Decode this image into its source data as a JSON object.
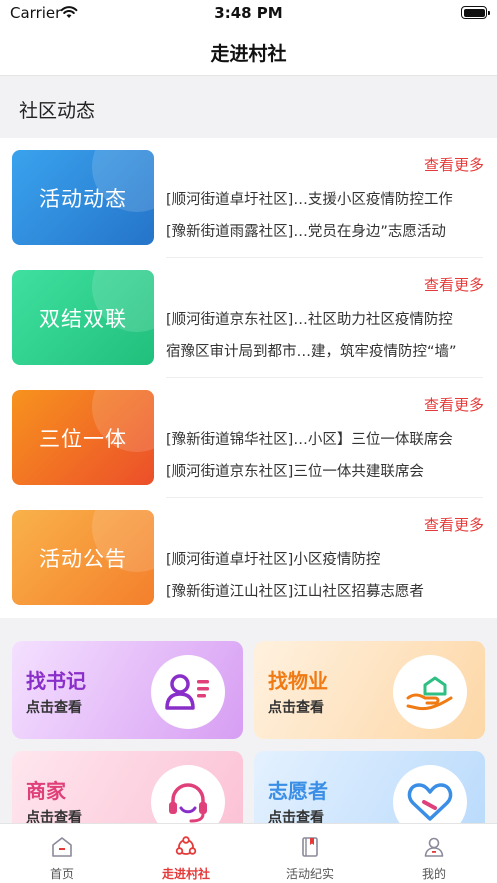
{
  "status_bar": {
    "carrier": "Carrier",
    "time": "3:48 PM"
  },
  "header": {
    "title": "走进村社"
  },
  "section": {
    "title": "社区动态"
  },
  "news": [
    {
      "tile": "活动动态",
      "more": "查看更多",
      "lines": [
        "[顺河街道卓圩社区]…支援小区疫情防控工作",
        "[豫新街道雨露社区]…党员在身边”志愿活动"
      ]
    },
    {
      "tile": "双结双联",
      "more": "查看更多",
      "lines": [
        "[顺河街道京东社区]…社区助力社区疫情防控",
        "宿豫区审计局到都市…建，筑牢疫情防控“墙”"
      ]
    },
    {
      "tile": "三位一体",
      "more": "查看更多",
      "lines": [
        "[豫新街道锦华社区]…小区】三位一体联席会",
        "[顺河街道京东社区]三位一体共建联席会"
      ]
    },
    {
      "tile": "活动公告",
      "more": "查看更多",
      "lines": [
        "[顺河街道卓圩社区]小区疫情防控",
        "[豫新街道江山社区]江山社区招募志愿者"
      ]
    }
  ],
  "services": [
    {
      "title": "找书记",
      "sub": "点击查看",
      "icon": "person-card-icon"
    },
    {
      "title": "找物业",
      "sub": "点击查看",
      "icon": "house-hand-icon"
    },
    {
      "title": "商家",
      "sub": "点击查看",
      "icon": "headset-icon"
    },
    {
      "title": "志愿者",
      "sub": "点击查看",
      "icon": "heart-icon"
    }
  ],
  "tabs": [
    {
      "label": "首页",
      "icon": "home-icon"
    },
    {
      "label": "走进村社",
      "icon": "community-icon",
      "active": true
    },
    {
      "label": "活动纪实",
      "icon": "book-icon"
    },
    {
      "label": "我的",
      "icon": "profile-icon"
    }
  ],
  "colors": {
    "accent_red": "#e53a3a",
    "tile_blue": "#2f86d6",
    "tile_green": "#2fcf8c",
    "tile_orange": "#f06a28",
    "tile_amber": "#f5922d",
    "purple": "#8a2ec9",
    "orange_text": "#f07a14",
    "pink_text": "#e0407a",
    "blue_text": "#3a8ee6"
  }
}
